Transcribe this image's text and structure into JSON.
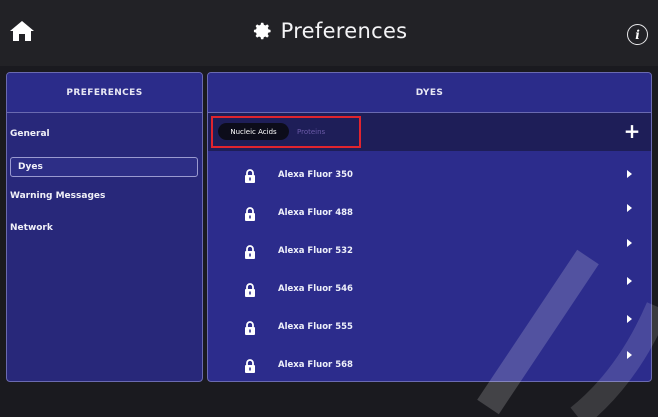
{
  "app": {
    "title": "Preferences",
    "home_icon": "home-icon",
    "title_icon": "gear-icon",
    "info_icon": "info-icon",
    "info_glyph": "i"
  },
  "left_panel": {
    "header": "PREFERENCES",
    "items": [
      {
        "label": "General",
        "selected": false
      },
      {
        "label": "Dyes",
        "selected": true
      },
      {
        "label": "Warning Messages",
        "selected": false
      },
      {
        "label": "Network",
        "selected": false
      }
    ]
  },
  "right_panel": {
    "header": "DYES",
    "tabs": [
      {
        "label": "Nucleic Acids",
        "active": true
      },
      {
        "label": "Proteins",
        "active": false
      }
    ],
    "add_glyph": "+",
    "dyes": [
      {
        "name": "Alexa Fluor 350",
        "locked": true
      },
      {
        "name": "Alexa Fluor 488",
        "locked": true
      },
      {
        "name": "Alexa Fluor 532",
        "locked": true
      },
      {
        "name": "Alexa Fluor 546",
        "locked": true
      },
      {
        "name": "Alexa Fluor 555",
        "locked": true
      },
      {
        "name": "Alexa Fluor 568",
        "locked": true
      }
    ]
  },
  "colors": {
    "topbar": "#222226",
    "panel": "#2c2c8c",
    "filter_bar": "#1e1e58",
    "highlight": "#e0242e"
  }
}
